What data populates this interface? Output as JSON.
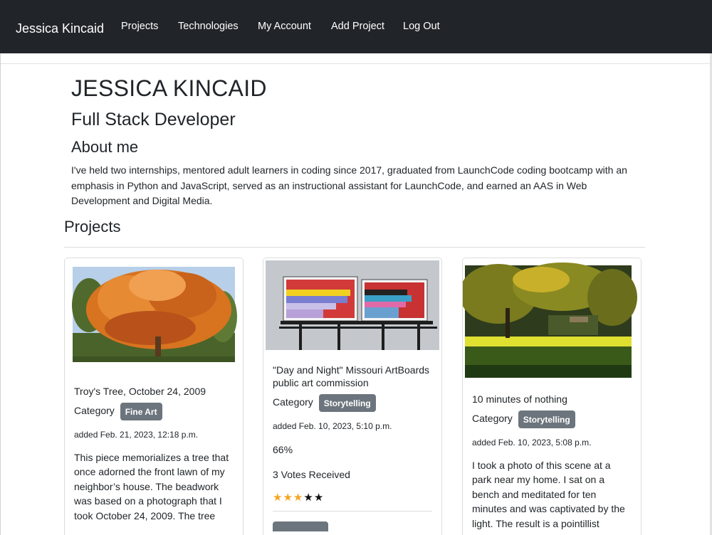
{
  "nav": {
    "brand": "Jessica Kincaid",
    "links": [
      "Projects",
      "Technologies",
      "My Account",
      "Add Project",
      "Log Out"
    ]
  },
  "profile": {
    "name": "JESSICA KINCAID",
    "role": "Full Stack Developer",
    "about_heading": "About me",
    "about_text": "I've held two internships, mentored adult learners in coding since 2017, graduated from LaunchCode coding bootcamp with an emphasis in Python and JavaScript, served as an instructional assistant for LaunchCode, and earned an AAS in Web Development and Digital Media."
  },
  "projects": {
    "heading": "Projects",
    "category_label": "Category",
    "cards": [
      {
        "title": "Troy's Tree, October 24, 2009",
        "category": "Fine Art",
        "added": "added Feb. 21, 2023, 12:18 p.m.",
        "description": "This piece memorializes a tree that once adorned the front lawn of my neighbor’s house. The beadwork was based on a photograph that I took October 24, 2009. The tree"
      },
      {
        "title": "\"Day and Night\" Missouri ArtBoards public art commission",
        "category": "Storytelling",
        "added": "added Feb. 10, 2023, 5:10 p.m.",
        "percent": "66%",
        "votes": "3 Votes Received",
        "rating": 3,
        "max_rating": 5
      },
      {
        "title": "10 minutes of nothing",
        "category": "Storytelling",
        "added": "added Feb. 10, 2023, 5:08 p.m.",
        "description": "I took a photo of this scene at a park near my home. I sat on a bench and meditated for ten minutes and was captivated by the light. The result is a pointillist"
      }
    ]
  },
  "colors": {
    "navbar": "#212529",
    "badge": "#6c757d",
    "star_filled": "#f5a623",
    "star_empty": "#111111"
  }
}
